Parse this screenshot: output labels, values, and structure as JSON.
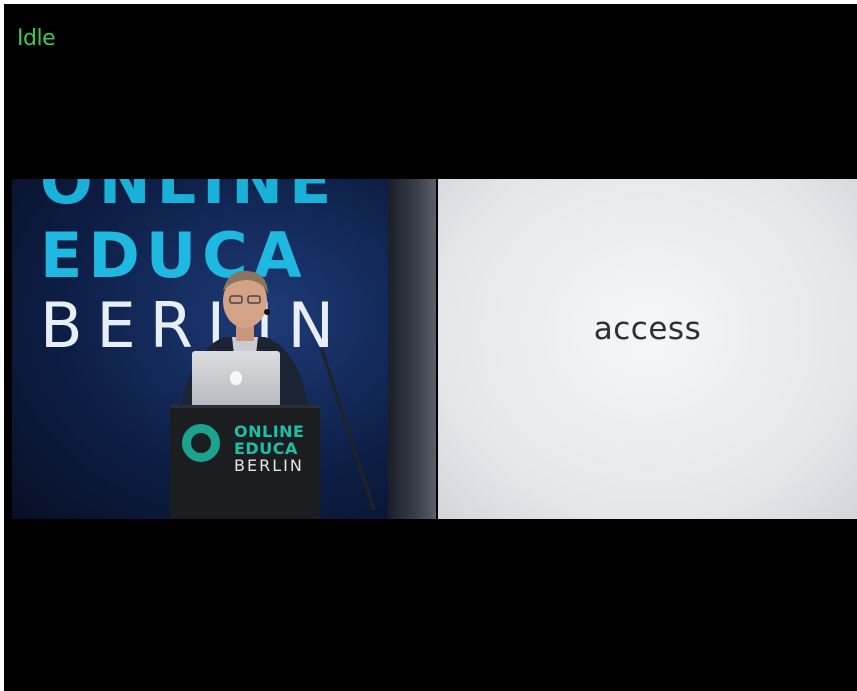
{
  "status": {
    "label": "Idle",
    "color": "#3fc94a"
  },
  "video": {
    "banner_lines": [
      "ONLINE",
      "EDUCA",
      "BERLIN"
    ],
    "podium_lines": [
      "ONLINE",
      "EDUCA",
      "BERLIN"
    ]
  },
  "slide": {
    "text": "access"
  },
  "colors": {
    "background": "#000000",
    "banner_blue": "#1fb8e0",
    "podium_teal": "#1ec0a5"
  }
}
